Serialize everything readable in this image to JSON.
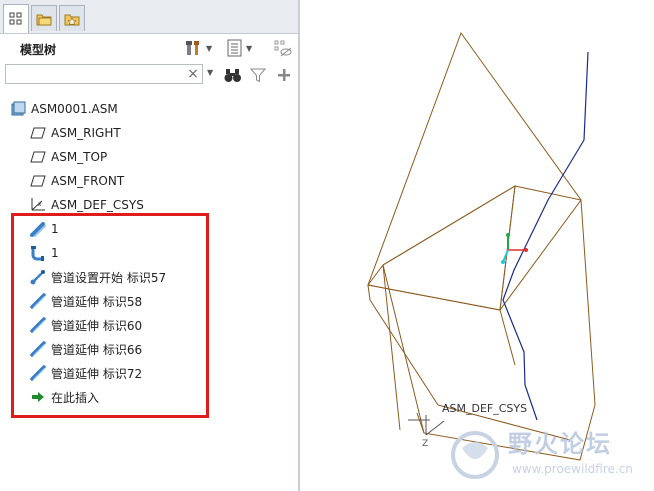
{
  "panel": {
    "title": "模型树",
    "search_value": "",
    "search_clear": "×"
  },
  "tree": {
    "items": [
      {
        "label": "ASM0001.ASM",
        "icon": "assembly-icon"
      },
      {
        "label": "ASM_RIGHT",
        "icon": "datum-plane-icon"
      },
      {
        "label": "ASM_TOP",
        "icon": "datum-plane-icon"
      },
      {
        "label": "ASM_FRONT",
        "icon": "datum-plane-icon"
      },
      {
        "label": "ASM_DEF_CSYS",
        "icon": "coordinate-system-icon"
      },
      {
        "label": "1",
        "icon": "piping-spool-icon"
      },
      {
        "label": "1",
        "icon": "piping-fitting-icon"
      },
      {
        "label": "管道设置开始 标识57",
        "icon": "pipe-start-icon"
      },
      {
        "label": "管道延伸 标识58",
        "icon": "pipe-extend-icon"
      },
      {
        "label": "管道延伸 标识60",
        "icon": "pipe-extend-icon"
      },
      {
        "label": "管道延伸 标识66",
        "icon": "pipe-extend-icon"
      },
      {
        "label": "管道延伸 标识72",
        "icon": "pipe-extend-icon"
      },
      {
        "label": "在此插入",
        "icon": "insert-here-arrow-icon"
      }
    ]
  },
  "viewport": {
    "csys_label": "ASM_DEF_CSYS",
    "watermark_text": "野火论坛",
    "watermark_url": "www.proewildfire.cn"
  },
  "colors": {
    "highlight": "#e01b1b",
    "datum_plane": "#8b5a1e",
    "pipe_path": "#1c2a8c",
    "csys_green": "#22aa44",
    "csys_cyan": "#22c8d8",
    "csys_red": "#e03030"
  }
}
